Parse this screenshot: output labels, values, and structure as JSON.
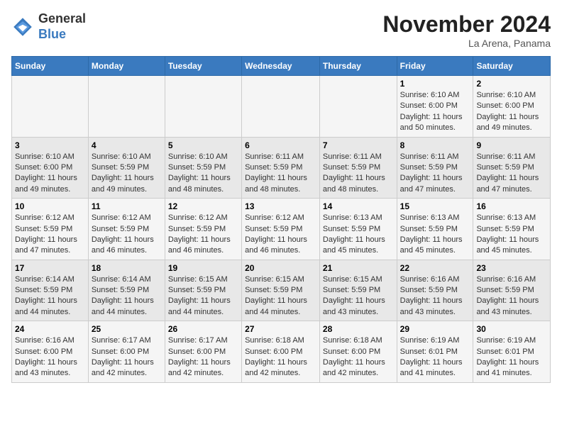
{
  "logo": {
    "general": "General",
    "blue": "Blue"
  },
  "title": "November 2024",
  "location": "La Arena, Panama",
  "days_of_week": [
    "Sunday",
    "Monday",
    "Tuesday",
    "Wednesday",
    "Thursday",
    "Friday",
    "Saturday"
  ],
  "weeks": [
    [
      {
        "day": "",
        "info": ""
      },
      {
        "day": "",
        "info": ""
      },
      {
        "day": "",
        "info": ""
      },
      {
        "day": "",
        "info": ""
      },
      {
        "day": "",
        "info": ""
      },
      {
        "day": "1",
        "info": "Sunrise: 6:10 AM\nSunset: 6:00 PM\nDaylight: 11 hours and 50 minutes."
      },
      {
        "day": "2",
        "info": "Sunrise: 6:10 AM\nSunset: 6:00 PM\nDaylight: 11 hours and 49 minutes."
      }
    ],
    [
      {
        "day": "3",
        "info": "Sunrise: 6:10 AM\nSunset: 6:00 PM\nDaylight: 11 hours and 49 minutes."
      },
      {
        "day": "4",
        "info": "Sunrise: 6:10 AM\nSunset: 5:59 PM\nDaylight: 11 hours and 49 minutes."
      },
      {
        "day": "5",
        "info": "Sunrise: 6:10 AM\nSunset: 5:59 PM\nDaylight: 11 hours and 48 minutes."
      },
      {
        "day": "6",
        "info": "Sunrise: 6:11 AM\nSunset: 5:59 PM\nDaylight: 11 hours and 48 minutes."
      },
      {
        "day": "7",
        "info": "Sunrise: 6:11 AM\nSunset: 5:59 PM\nDaylight: 11 hours and 48 minutes."
      },
      {
        "day": "8",
        "info": "Sunrise: 6:11 AM\nSunset: 5:59 PM\nDaylight: 11 hours and 47 minutes."
      },
      {
        "day": "9",
        "info": "Sunrise: 6:11 AM\nSunset: 5:59 PM\nDaylight: 11 hours and 47 minutes."
      }
    ],
    [
      {
        "day": "10",
        "info": "Sunrise: 6:12 AM\nSunset: 5:59 PM\nDaylight: 11 hours and 47 minutes."
      },
      {
        "day": "11",
        "info": "Sunrise: 6:12 AM\nSunset: 5:59 PM\nDaylight: 11 hours and 46 minutes."
      },
      {
        "day": "12",
        "info": "Sunrise: 6:12 AM\nSunset: 5:59 PM\nDaylight: 11 hours and 46 minutes."
      },
      {
        "day": "13",
        "info": "Sunrise: 6:12 AM\nSunset: 5:59 PM\nDaylight: 11 hours and 46 minutes."
      },
      {
        "day": "14",
        "info": "Sunrise: 6:13 AM\nSunset: 5:59 PM\nDaylight: 11 hours and 45 minutes."
      },
      {
        "day": "15",
        "info": "Sunrise: 6:13 AM\nSunset: 5:59 PM\nDaylight: 11 hours and 45 minutes."
      },
      {
        "day": "16",
        "info": "Sunrise: 6:13 AM\nSunset: 5:59 PM\nDaylight: 11 hours and 45 minutes."
      }
    ],
    [
      {
        "day": "17",
        "info": "Sunrise: 6:14 AM\nSunset: 5:59 PM\nDaylight: 11 hours and 44 minutes."
      },
      {
        "day": "18",
        "info": "Sunrise: 6:14 AM\nSunset: 5:59 PM\nDaylight: 11 hours and 44 minutes."
      },
      {
        "day": "19",
        "info": "Sunrise: 6:15 AM\nSunset: 5:59 PM\nDaylight: 11 hours and 44 minutes."
      },
      {
        "day": "20",
        "info": "Sunrise: 6:15 AM\nSunset: 5:59 PM\nDaylight: 11 hours and 44 minutes."
      },
      {
        "day": "21",
        "info": "Sunrise: 6:15 AM\nSunset: 5:59 PM\nDaylight: 11 hours and 43 minutes."
      },
      {
        "day": "22",
        "info": "Sunrise: 6:16 AM\nSunset: 5:59 PM\nDaylight: 11 hours and 43 minutes."
      },
      {
        "day": "23",
        "info": "Sunrise: 6:16 AM\nSunset: 5:59 PM\nDaylight: 11 hours and 43 minutes."
      }
    ],
    [
      {
        "day": "24",
        "info": "Sunrise: 6:16 AM\nSunset: 6:00 PM\nDaylight: 11 hours and 43 minutes."
      },
      {
        "day": "25",
        "info": "Sunrise: 6:17 AM\nSunset: 6:00 PM\nDaylight: 11 hours and 42 minutes."
      },
      {
        "day": "26",
        "info": "Sunrise: 6:17 AM\nSunset: 6:00 PM\nDaylight: 11 hours and 42 minutes."
      },
      {
        "day": "27",
        "info": "Sunrise: 6:18 AM\nSunset: 6:00 PM\nDaylight: 11 hours and 42 minutes."
      },
      {
        "day": "28",
        "info": "Sunrise: 6:18 AM\nSunset: 6:00 PM\nDaylight: 11 hours and 42 minutes."
      },
      {
        "day": "29",
        "info": "Sunrise: 6:19 AM\nSunset: 6:01 PM\nDaylight: 11 hours and 41 minutes."
      },
      {
        "day": "30",
        "info": "Sunrise: 6:19 AM\nSunset: 6:01 PM\nDaylight: 11 hours and 41 minutes."
      }
    ]
  ]
}
